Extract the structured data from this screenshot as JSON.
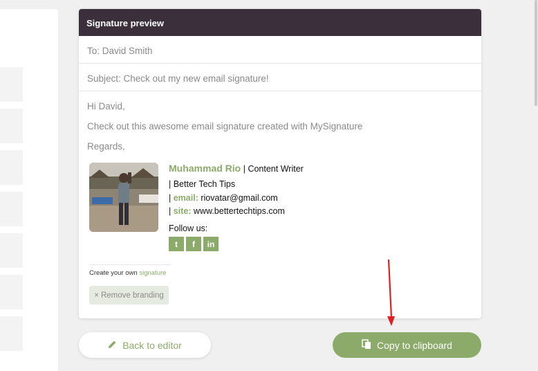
{
  "card": {
    "title": "Signature preview",
    "to": "To: David Smith",
    "subject": "Subject: Check out my new email signature!",
    "body_lines": [
      "Hi David,",
      "Check out this awesome email signature created with MySignature",
      "Regards,"
    ]
  },
  "signature": {
    "name": "Muhammad Rio",
    "separator": "|",
    "title": "Content Writer",
    "company_line": "| Better Tech Tips",
    "email_label": "email:",
    "email": "riovatar@gmail.com",
    "site_label": "site:",
    "site": "www.bettertechtips.com",
    "follow": "Follow us:",
    "socials": [
      {
        "icon": "twitter-icon",
        "glyph": "t"
      },
      {
        "icon": "facebook-icon",
        "glyph": "f"
      },
      {
        "icon": "linkedin-icon",
        "glyph": "in"
      }
    ]
  },
  "branding": {
    "create_text": "Create your own",
    "create_link": "signature",
    "remove_label": "Remove branding",
    "remove_glyph": "×"
  },
  "buttons": {
    "back_label": "Back to editor",
    "copy_label": "Copy to clipboard"
  },
  "colors": {
    "header_bg": "#3b2f3c",
    "accent_green": "#8cab6a",
    "arrow": "#e02020"
  }
}
